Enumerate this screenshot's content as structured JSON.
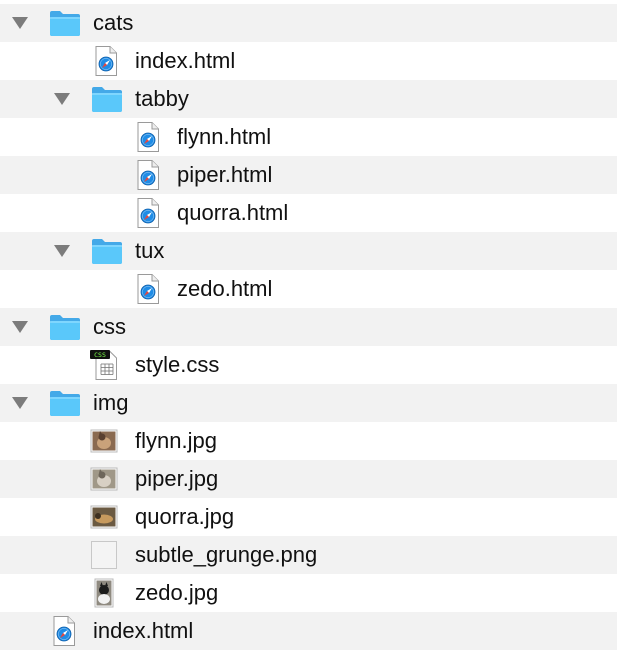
{
  "file_tree": {
    "rows": [
      {
        "label": "cats",
        "kind": "folder",
        "depth": 0,
        "expanded": true
      },
      {
        "label": "index.html",
        "kind": "html",
        "depth": 1
      },
      {
        "label": "tabby",
        "kind": "folder",
        "depth": 1,
        "expanded": true
      },
      {
        "label": "flynn.html",
        "kind": "html",
        "depth": 2
      },
      {
        "label": "piper.html",
        "kind": "html",
        "depth": 2
      },
      {
        "label": "quorra.html",
        "kind": "html",
        "depth": 2
      },
      {
        "label": "tux",
        "kind": "folder",
        "depth": 1,
        "expanded": true
      },
      {
        "label": "zedo.html",
        "kind": "html",
        "depth": 2
      },
      {
        "label": "css",
        "kind": "folder",
        "depth": 0,
        "expanded": true
      },
      {
        "label": "style.css",
        "kind": "css",
        "depth": 1
      },
      {
        "label": "img",
        "kind": "folder",
        "depth": 0,
        "expanded": true
      },
      {
        "label": "flynn.jpg",
        "kind": "image",
        "depth": 1,
        "thumb": "cat-tabby"
      },
      {
        "label": "piper.jpg",
        "kind": "image",
        "depth": 1,
        "thumb": "cat-grey"
      },
      {
        "label": "quorra.jpg",
        "kind": "image",
        "depth": 1,
        "thumb": "cat-lying"
      },
      {
        "label": "subtle_grunge.png",
        "kind": "image",
        "depth": 1,
        "thumb": "blank"
      },
      {
        "label": "zedo.jpg",
        "kind": "image",
        "depth": 1,
        "thumb": "cat-tuxedo"
      },
      {
        "label": "index.html",
        "kind": "html",
        "depth": 0
      }
    ],
    "colors": {
      "stripe": "#f2f2f2",
      "folder": "#5ac8fa",
      "disclosure": "#7c7c7c",
      "safari_blue": "#1f8ce6"
    },
    "icons": {
      "folder": "folder-icon",
      "html": "html-file-icon",
      "css": "css-file-icon",
      "image": "image-thumbnail-icon",
      "disclosure": "disclosure-triangle-icon"
    }
  }
}
